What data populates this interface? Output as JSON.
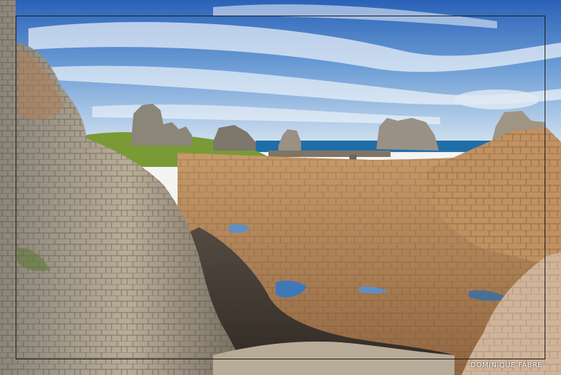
{
  "photo": {
    "subject": "rocky-coastline-landscape",
    "colors": {
      "sky_top": "#2f6fc4",
      "sky_bottom": "#cfe0f1",
      "sea": "#1f6ea8",
      "grass": "#7a9a36",
      "rock_light": "#c9bfae",
      "rock_warm": "#b98a5c",
      "rock_dark": "#3b3733",
      "pool": "#5d90c4"
    }
  },
  "watermark": {
    "text": "DOMINIQUE FABRE"
  }
}
